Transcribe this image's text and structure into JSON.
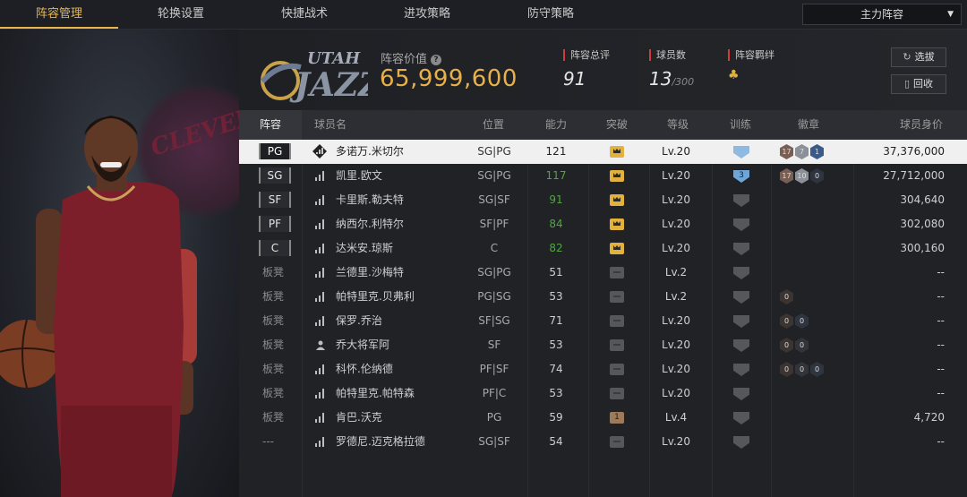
{
  "tabs": [
    {
      "label": "阵容管理",
      "active": true
    },
    {
      "label": "轮换设置",
      "active": false
    },
    {
      "label": "快捷战术",
      "active": false
    },
    {
      "label": "进攻策略",
      "active": false
    },
    {
      "label": "防守策略",
      "active": false
    }
  ],
  "lineup_select": {
    "value": "主力阵容"
  },
  "team": {
    "logo_text": "UTAH JAZZ"
  },
  "header": {
    "value_label": "阵容价值",
    "value": "65,999,600",
    "overall_label": "阵容总评",
    "overall": "91",
    "players_label": "球员数",
    "players": "13",
    "players_max": "/300",
    "chemistry_label": "阵容羁绊",
    "btn_select": "选拔",
    "btn_recycle": "回收"
  },
  "columns": {
    "lineup": "阵容",
    "name": "球员名",
    "position": "位置",
    "ability": "能力",
    "breakthrough": "突破",
    "level": "等级",
    "training": "训练",
    "badges": "徽章",
    "worth": "球员身价"
  },
  "roster": [
    {
      "slot": "PG",
      "bench": false,
      "name": "多诺万.米切尔",
      "pos": "SG|PG",
      "ability": "121",
      "green": false,
      "crown": "gold",
      "level": "Lv.20",
      "train": "blue",
      "train_num": "",
      "badges": [
        {
          "c": "b",
          "t": "17"
        },
        {
          "c": "s",
          "t": "7"
        },
        {
          "c": "bl",
          "t": "1"
        }
      ],
      "worth": "37,376,000",
      "selected": true,
      "icon": "diamond"
    },
    {
      "slot": "SG",
      "bench": false,
      "name": "凯里.欧文",
      "pos": "SG|PG",
      "ability": "117",
      "green": true,
      "crown": "gold",
      "level": "Lv.20",
      "train": "blue",
      "train_num": "3",
      "badges": [
        {
          "c": "b",
          "t": "17"
        },
        {
          "c": "s",
          "t": "10"
        },
        {
          "c": "e2",
          "t": "0"
        }
      ],
      "worth": "27,712,000"
    },
    {
      "slot": "SF",
      "bench": false,
      "name": "卡里斯.勒夫特",
      "pos": "SG|SF",
      "ability": "91",
      "green": true,
      "crown": "gold",
      "level": "Lv.20",
      "train": "grey",
      "badges": [],
      "worth": "304,640"
    },
    {
      "slot": "PF",
      "bench": false,
      "name": "纳西尔.利特尔",
      "pos": "SF|PF",
      "ability": "84",
      "green": true,
      "crown": "gold",
      "level": "Lv.20",
      "train": "grey",
      "badges": [],
      "worth": "302,080"
    },
    {
      "slot": "C",
      "bench": false,
      "name": "达米安.琼斯",
      "pos": "C",
      "ability": "82",
      "green": true,
      "crown": "gold",
      "level": "Lv.20",
      "train": "grey",
      "badges": [],
      "worth": "300,160"
    },
    {
      "slot": "板凳",
      "bench": true,
      "name": "兰德里.沙梅特",
      "pos": "SG|PG",
      "ability": "51",
      "green": false,
      "crown": "grey",
      "level": "Lv.2",
      "train": "grey",
      "badges": [],
      "worth": "--"
    },
    {
      "slot": "板凳",
      "bench": true,
      "name": "帕特里克.贝弗利",
      "pos": "PG|SG",
      "ability": "53",
      "green": false,
      "crown": "grey",
      "level": "Lv.2",
      "train": "grey",
      "badges": [
        {
          "c": "e1",
          "t": "0"
        }
      ],
      "worth": "--"
    },
    {
      "slot": "板凳",
      "bench": true,
      "name": "保罗.乔治",
      "pos": "SF|SG",
      "ability": "71",
      "green": false,
      "crown": "grey",
      "level": "Lv.20",
      "train": "grey",
      "badges": [
        {
          "c": "e1",
          "t": "0"
        },
        {
          "c": "e2",
          "t": "0"
        }
      ],
      "worth": "--"
    },
    {
      "slot": "板凳",
      "bench": true,
      "name": "乔大将军阿",
      "pos": "SF",
      "ability": "53",
      "green": false,
      "crown": "grey",
      "level": "Lv.20",
      "train": "grey",
      "badges": [
        {
          "c": "e1",
          "t": "0"
        },
        {
          "c": "e3",
          "t": "0"
        }
      ],
      "worth": "--",
      "icon": "person"
    },
    {
      "slot": "板凳",
      "bench": true,
      "name": "科怀.伦纳德",
      "pos": "PF|SF",
      "ability": "74",
      "green": false,
      "crown": "grey",
      "level": "Lv.20",
      "train": "grey",
      "badges": [
        {
          "c": "e1",
          "t": "0"
        },
        {
          "c": "e3",
          "t": "0"
        },
        {
          "c": "e2",
          "t": "0"
        }
      ],
      "worth": "--"
    },
    {
      "slot": "板凳",
      "bench": true,
      "name": "帕特里克.帕特森",
      "pos": "PF|C",
      "ability": "53",
      "green": false,
      "crown": "grey",
      "level": "Lv.20",
      "train": "grey",
      "badges": [],
      "worth": "--"
    },
    {
      "slot": "板凳",
      "bench": true,
      "name": "肯巴.沃克",
      "pos": "PG",
      "ability": "59",
      "green": false,
      "crown": "bronze",
      "crown_num": "1",
      "level": "Lv.4",
      "train": "grey",
      "badges": [],
      "worth": "4,720"
    },
    {
      "slot": "---",
      "bench": true,
      "name": "罗德尼.迈克格拉德",
      "pos": "SG|SF",
      "ability": "54",
      "green": false,
      "crown": "grey",
      "level": "Lv.20",
      "train": "grey",
      "badges": [],
      "worth": "--"
    }
  ]
}
